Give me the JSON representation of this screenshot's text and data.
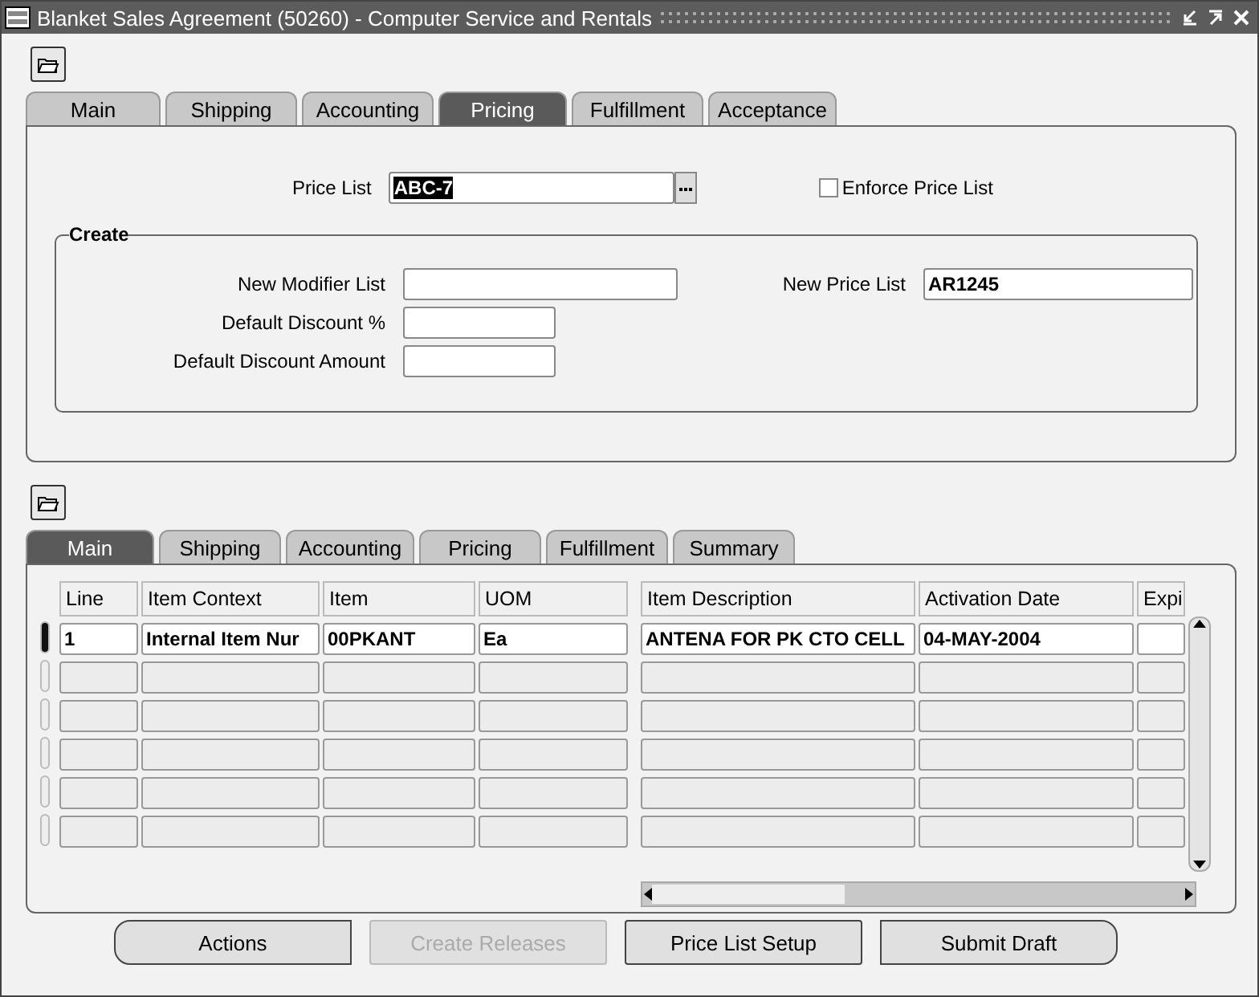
{
  "window": {
    "title": "Blanket Sales Agreement (50260) - Computer Service and Rentals"
  },
  "header_tabs": [
    {
      "label": "Main",
      "selected": false
    },
    {
      "label": "Shipping",
      "selected": false
    },
    {
      "label": "Accounting",
      "selected": false
    },
    {
      "label": "Pricing",
      "selected": true
    },
    {
      "label": "Fulfillment",
      "selected": false
    },
    {
      "label": "Acceptance",
      "selected": false
    }
  ],
  "price_list": {
    "label": "Price List",
    "value": "ABC-7"
  },
  "enforce_price_list": {
    "label": "Enforce Price List",
    "checked": false
  },
  "create": {
    "title": "Create",
    "fields": [
      {
        "label": "New Modifier List",
        "kind": "wide"
      },
      {
        "label": "Default Discount %",
        "kind": "short"
      },
      {
        "label": "Default Discount Amount",
        "kind": "short"
      }
    ],
    "new_price_list": {
      "label": "New Price List",
      "value": "AR1245"
    }
  },
  "line_tabs": [
    {
      "label": "Main",
      "selected": true
    },
    {
      "label": "Shipping",
      "selected": false
    },
    {
      "label": "Accounting",
      "selected": false
    },
    {
      "label": "Pricing",
      "selected": false
    },
    {
      "label": "Fulfillment",
      "selected": false
    },
    {
      "label": "Summary",
      "selected": false
    }
  ],
  "table": {
    "columns": [
      "Line",
      "Item Context",
      "Item",
      "UOM",
      "Item Description",
      "Activation Date",
      "Expi"
    ],
    "rows": [
      {
        "current": true,
        "cells": [
          "1",
          "Internal Item Nur",
          "00PKANT",
          "Ea",
          "ANTENA FOR PK CTO CELL",
          "04-MAY-2004",
          ""
        ]
      },
      {
        "current": false
      },
      {
        "current": false
      },
      {
        "current": false
      },
      {
        "current": false
      },
      {
        "current": false
      }
    ]
  },
  "buttons": [
    {
      "label": "Actions",
      "disabled": false
    },
    {
      "label": "Create Releases",
      "disabled": true
    },
    {
      "label": "Price List Setup",
      "disabled": false
    },
    {
      "label": "Submit Draft",
      "disabled": false
    }
  ]
}
